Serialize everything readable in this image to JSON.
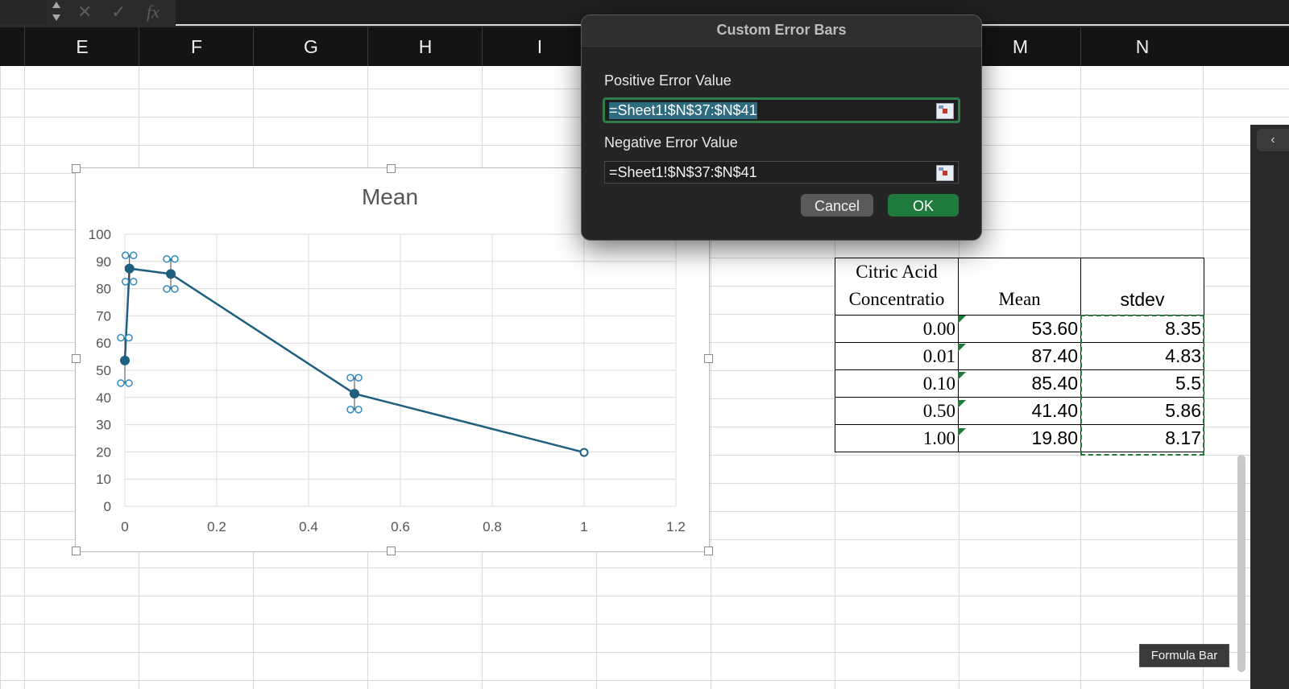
{
  "formula_bar": {
    "cancel_glyph": "✕",
    "enter_glyph": "✓",
    "fx_glyph": "fx"
  },
  "columns": [
    "E",
    "F",
    "G",
    "H",
    "I",
    "M",
    "N"
  ],
  "chart": {
    "title": "Mean"
  },
  "chart_data": {
    "type": "scatter",
    "title": "Mean",
    "x": [
      0.0,
      0.01,
      0.1,
      0.5,
      1.0
    ],
    "y": [
      53.6,
      87.4,
      85.4,
      41.4,
      19.8
    ],
    "error": [
      8.35,
      4.83,
      5.5,
      5.86,
      8.17
    ],
    "xlim": [
      0,
      1.2
    ],
    "ylim": [
      0,
      100
    ],
    "x_ticks": [
      "0",
      "0.2",
      "0.4",
      "0.6",
      "0.8",
      "1",
      "1.2"
    ],
    "y_ticks": [
      "0",
      "10",
      "20",
      "30",
      "40",
      "50",
      "60",
      "70",
      "80",
      "90",
      "100"
    ],
    "grid": true,
    "series_color": "#1f5f7f",
    "error_bar_color": "#2e8bc0"
  },
  "table": {
    "headers": {
      "concentration": [
        "Citric Acid",
        "Concentratio"
      ],
      "mean": "Mean",
      "stdev": "stdev"
    },
    "rows": [
      {
        "conc": "0.00",
        "mean": "53.60",
        "stdev": "8.35"
      },
      {
        "conc": "0.01",
        "mean": "87.40",
        "stdev": "4.83"
      },
      {
        "conc": "0.10",
        "mean": "85.40",
        "stdev": "5.5"
      },
      {
        "conc": "0.50",
        "mean": "41.40",
        "stdev": "5.86"
      },
      {
        "conc": "1.00",
        "mean": "19.80",
        "stdev": "8.17"
      }
    ]
  },
  "dialog": {
    "title": "Custom Error Bars",
    "positive_label": "Positive Error Value",
    "positive_value": "=Sheet1!$N$37:$N$41",
    "negative_label": "Negative Error Value",
    "negative_value": "=Sheet1!$N$37:$N$41",
    "cancel": "Cancel",
    "ok": "OK"
  },
  "tooltip": "Formula Bar",
  "colors": {
    "accent_green": "#1f7a3e",
    "dark_bg": "#252526"
  }
}
